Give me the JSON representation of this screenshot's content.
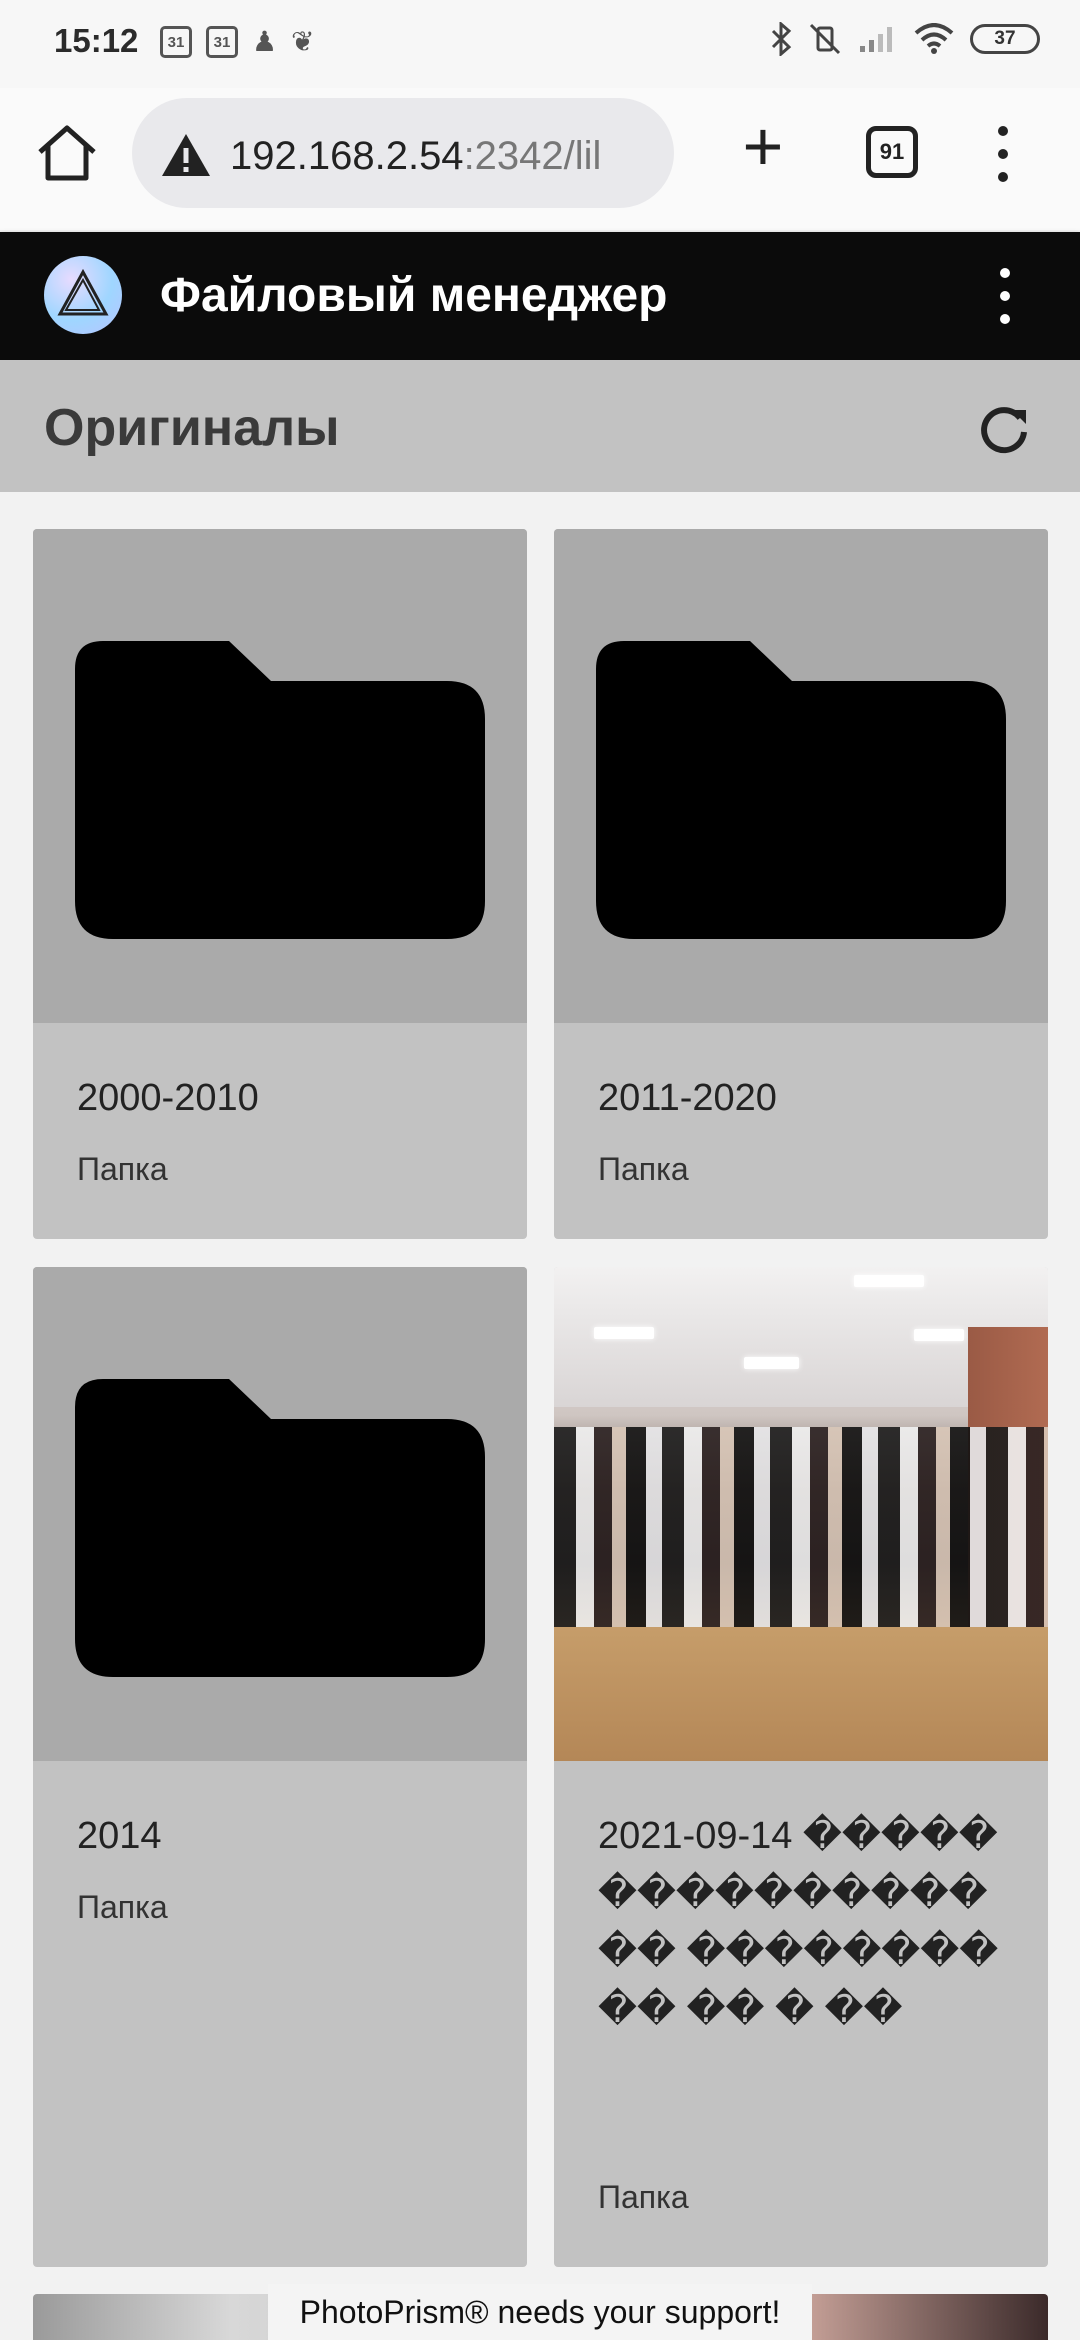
{
  "status_bar": {
    "time": "15:12",
    "calendar_1": "31",
    "calendar_2": "31",
    "battery": "37",
    "icons": [
      "calendar-icon",
      "calendar-icon",
      "duck-icon",
      "bird-icon",
      "bluetooth-icon",
      "vibrate-off-icon",
      "signal-icon",
      "wifi-icon",
      "battery-icon"
    ]
  },
  "browser": {
    "url_host": "192.168.2.54",
    "url_rest": ":2342/lil",
    "tab_count": "91",
    "icons": [
      "home-icon",
      "warning-icon",
      "plus-icon",
      "tabs-icon",
      "more-vert-icon"
    ]
  },
  "app": {
    "title": "Файловый менеджер",
    "toolbar_title": "Оригиналы",
    "icons": [
      "app-logo",
      "more-vert-icon",
      "refresh-icon"
    ]
  },
  "items": [
    {
      "name": "2000-2010",
      "type": "Папка",
      "kind": "folder"
    },
    {
      "name": "2011-2020",
      "type": "Папка",
      "kind": "folder"
    },
    {
      "name": "2014",
      "type": "Папка",
      "kind": "folder"
    },
    {
      "name": "2021-09-14 ����� ���������� �� ���������� �� � ��",
      "type": "Папка",
      "kind": "photo"
    }
  ],
  "banner": "PhotoPrism® needs your support!",
  "colors": {
    "app_bar": "#0b0b0b",
    "toolbar": "#c2c2c2",
    "card": "#c2c2c2",
    "thumb": "#aaaaaa",
    "background": "#f2f2f2"
  }
}
